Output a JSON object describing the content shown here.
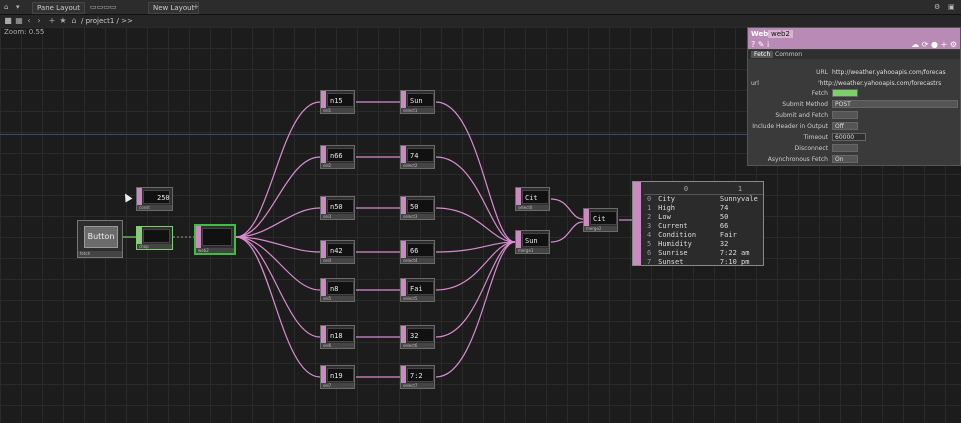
{
  "toolbar": {
    "pane_layout": "Pane Layout",
    "new_layout": "New Layout",
    "path": "/ project1 / >>"
  },
  "zoom_label": "Zoom: 0.55",
  "nodes": {
    "button": "Button",
    "constant": "250",
    "in_n15": "n15",
    "out_n15": "Sun",
    "in_n66": "n66",
    "out_n66": "74",
    "in_n50": "n50",
    "out_n50": "50",
    "in_n42": "n42",
    "out_n42": "66",
    "in_n8": "n8",
    "out_n8": "Fai",
    "in_n18": "n18",
    "out_n18": "32",
    "in_n19": "n19",
    "out_n19": "7:2",
    "city": "Cit",
    "merge1": "Sun",
    "merge2": "Cit"
  },
  "table": {
    "header": [
      "0",
      "1"
    ],
    "rows": [
      [
        "0",
        "City",
        "Sunnyvale"
      ],
      [
        "1",
        "High",
        "74"
      ],
      [
        "2",
        "Low",
        "50"
      ],
      [
        "3",
        "Current",
        "66"
      ],
      [
        "4",
        "Condition",
        "Fair"
      ],
      [
        "5",
        "Humidity",
        "32"
      ],
      [
        "6",
        "Sunrise",
        "7:22 am"
      ],
      [
        "7",
        "Sunset",
        "7:10 pm"
      ]
    ]
  },
  "panel": {
    "title": "Web",
    "name": "web2",
    "tabs": [
      "Fetch",
      "Common"
    ],
    "url_label": "URL",
    "url_value": "http://weather.yahooapis.com/forecas",
    "url_row_label": "url",
    "url_row_value": "'http://weather.yahooapis.com/forecastrs",
    "fetch": "Fetch",
    "submit_method": "Submit Method",
    "submit_method_value": "POST",
    "submit_and_fetch": "Submit and Fetch",
    "include_header": "Include Header in Output",
    "include_header_value": "Off",
    "timeout": "Timeout",
    "timeout_value": "60000",
    "disconnect": "Disconnect",
    "async_fetch": "Asynchronous Fetch",
    "async_fetch_value": "On"
  }
}
